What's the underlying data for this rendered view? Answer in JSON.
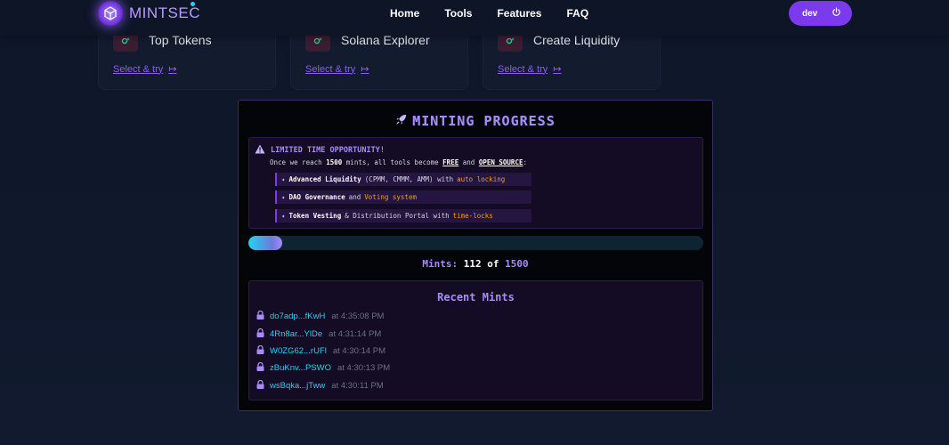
{
  "brand": {
    "name": "MINTSEC"
  },
  "nav": {
    "links": [
      "Home",
      "Tools",
      "Features",
      "FAQ"
    ]
  },
  "user": {
    "label": "dev"
  },
  "tools": [
    {
      "title": "Top Tokens",
      "link": "Select & try"
    },
    {
      "title": "Solana Explorer",
      "link": "Select & try"
    },
    {
      "title": "Create Liquidity",
      "link": "Select & try"
    }
  ],
  "minting": {
    "title": "MINTING PROGRESS",
    "opportunity": {
      "heading": "LIMITED TIME OPPORTUNITY!",
      "line_prefix": "Once we reach",
      "threshold": "1500",
      "line_mid": "mints, all tools become",
      "free": "FREE",
      "and": "and",
      "open_source": "OPEN SOURCE",
      "colon": ":",
      "features": [
        {
          "bold": "Advanced Liquidity",
          "text": "(CPMM, CMMM, AMM) with",
          "highlight": "auto locking"
        },
        {
          "bold": "DAO Governance",
          "text": "and",
          "highlight": "Voting system"
        },
        {
          "bold": "Token Vesting",
          "text": "& Distribution Portal with",
          "highlight": "time-locks"
        }
      ]
    },
    "progress": {
      "current": 112,
      "total": 1500
    },
    "count_label": "Mints:",
    "count_current": "112",
    "count_of": "of",
    "count_total": "1500",
    "recent": {
      "title": "Recent Mints",
      "items": [
        {
          "address": "do7adp...fKwH",
          "time": "at 4:35:08 PM"
        },
        {
          "address": "4Rn8ar...YlDe",
          "time": "at 4:31:14 PM"
        },
        {
          "address": "W0ZG62...rUFl",
          "time": "at 4:30:14 PM"
        },
        {
          "address": "zBuKnv...PSWO",
          "time": "at 4:30:13 PM"
        },
        {
          "address": "wsBqka...jTww",
          "time": "at 4:30:11 PM"
        }
      ]
    }
  },
  "colors": {
    "accent": "#7c3aed",
    "cyan": "#22d3ee",
    "amber": "#f59e0b"
  },
  "icons": {
    "logo": "cube-icon",
    "user": "power-icon",
    "tool": "sparkle-icon",
    "title": "rocket-icon",
    "warning": "warning-icon",
    "lock": "lock-icon"
  }
}
